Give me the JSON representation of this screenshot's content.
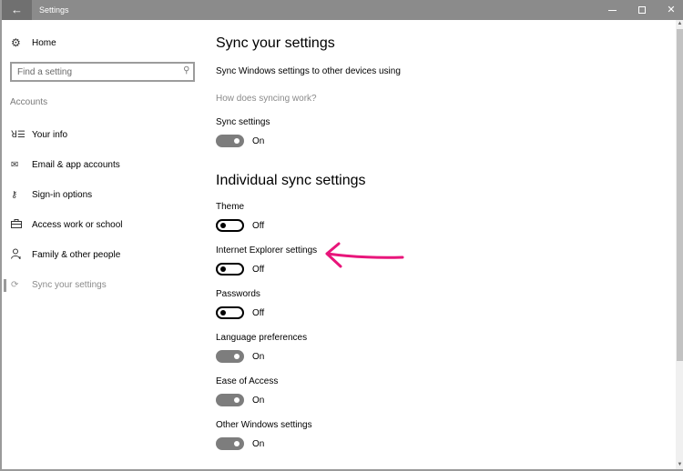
{
  "window": {
    "title": "Settings",
    "back_icon": "←",
    "controls": {
      "minimize": "minimize",
      "maximize": "maximize",
      "close": "✕"
    }
  },
  "sidebar": {
    "home": {
      "icon": "gear-icon",
      "glyph": "⚙",
      "label": "Home"
    },
    "search": {
      "placeholder": "Find a setting",
      "value": "",
      "icon": "⚲"
    },
    "section_label": "Accounts",
    "items": [
      {
        "label": "Your info",
        "icon": "contact-card-icon",
        "glyph": "ꓤ☰",
        "selected": false
      },
      {
        "label": "Email & app accounts",
        "icon": "mail-icon",
        "glyph": "✉",
        "selected": false
      },
      {
        "label": "Sign-in options",
        "icon": "key-icon",
        "glyph": "⚷",
        "selected": false
      },
      {
        "label": "Access work or school",
        "icon": "briefcase-icon",
        "glyph": "💼",
        "selected": false
      },
      {
        "label": "Family & other people",
        "icon": "person-add-icon",
        "glyph": "⚲",
        "selected": false
      },
      {
        "label": "Sync your settings",
        "icon": "sync-icon",
        "glyph": "⟳",
        "selected": true
      }
    ]
  },
  "main": {
    "title": "Sync your settings",
    "description": "Sync Windows settings to other devices using",
    "help_link": "How does syncing work?",
    "sync_settings": {
      "label": "Sync settings",
      "state": "On",
      "on": true
    },
    "individual_title": "Individual sync settings",
    "individual": [
      {
        "label": "Theme",
        "state": "Off",
        "on": false
      },
      {
        "label": "Internet Explorer settings",
        "state": "Off",
        "on": false
      },
      {
        "label": "Passwords",
        "state": "Off",
        "on": false
      },
      {
        "label": "Language preferences",
        "state": "On",
        "on": true
      },
      {
        "label": "Ease of Access",
        "state": "On",
        "on": true
      },
      {
        "label": "Other Windows settings",
        "state": "On",
        "on": true
      }
    ]
  },
  "annotation": {
    "type": "arrow",
    "color": "#e8157a",
    "points_to": "Internet Explorer settings"
  },
  "colors": {
    "titlebar": "#8b8b8b",
    "back_button": "#707070",
    "toggle_on": "#7d7d7d",
    "link": "#8a8a8a"
  }
}
